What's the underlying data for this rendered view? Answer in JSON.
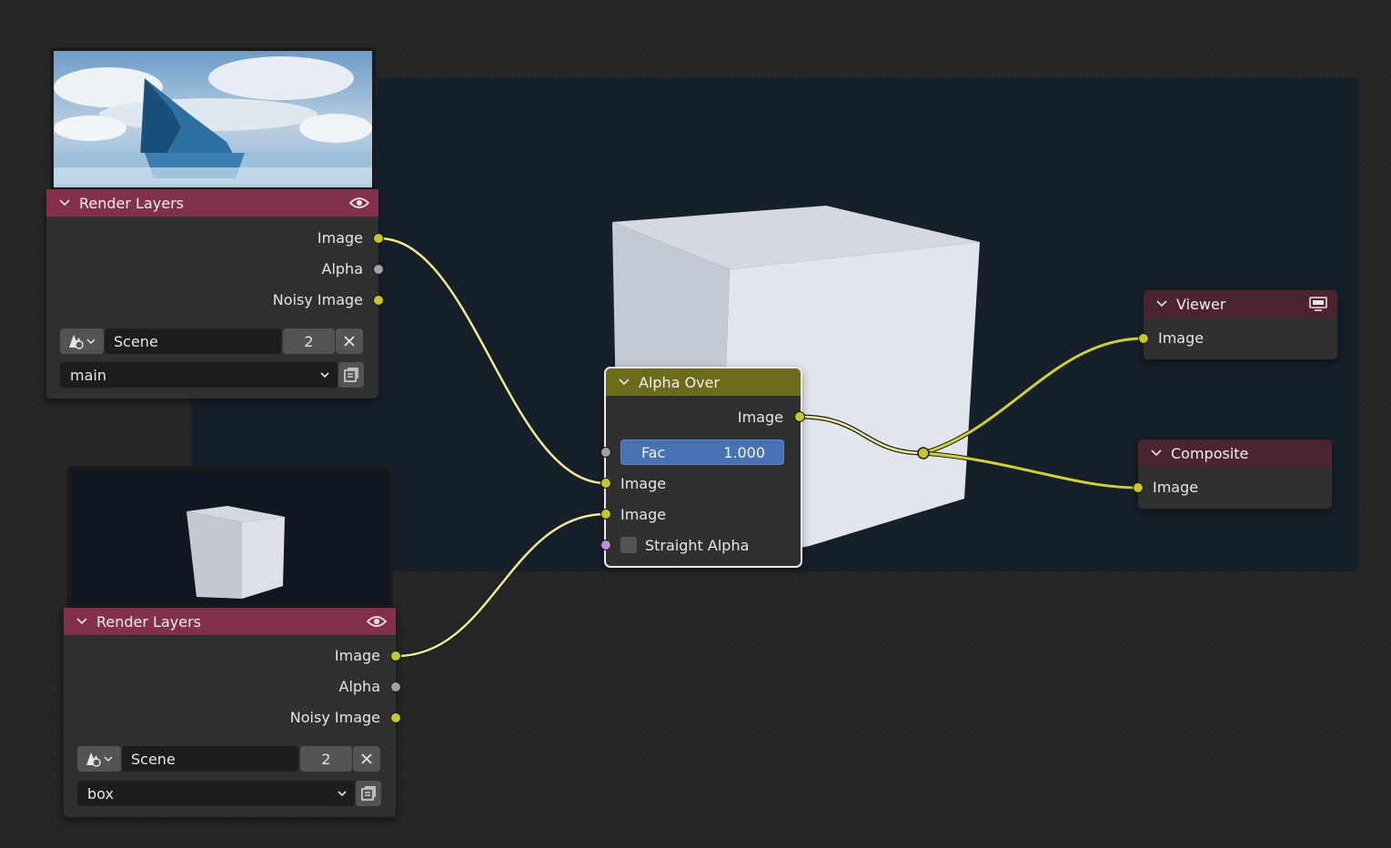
{
  "colors": {
    "canvas_bg": "#262626",
    "node_bg": "#303030",
    "input_header": "#83314a",
    "output_header": "#4d2331",
    "color_header": "#6e6a1b",
    "socket_image": "#c7c729",
    "socket_float": "#a1a1a1",
    "socket_bool": "#c28be0",
    "link": "#ecec9c",
    "slider": "#4772b3"
  },
  "render_layers_1": {
    "title": "Render Layers",
    "header_icon": "eye-icon",
    "outputs": [
      "Image",
      "Alpha",
      "Noisy Image"
    ],
    "scene_name": "Scene",
    "scene_users": "2",
    "view_layer": "main"
  },
  "render_layers_2": {
    "title": "Render Layers",
    "header_icon": "eye-icon",
    "outputs": [
      "Image",
      "Alpha",
      "Noisy Image"
    ],
    "scene_name": "Scene",
    "scene_users": "2",
    "view_layer": "box"
  },
  "alpha_over": {
    "title": "Alpha Over",
    "output": "Image",
    "fac_label": "Fac",
    "fac_value": "1.000",
    "inputs": [
      "Image",
      "Image"
    ],
    "straight_alpha_label": "Straight Alpha",
    "straight_alpha_checked": false
  },
  "viewer": {
    "title": "Viewer",
    "header_icon": "monitor-icon",
    "input": "Image"
  },
  "composite": {
    "title": "Composite",
    "input": "Image"
  }
}
